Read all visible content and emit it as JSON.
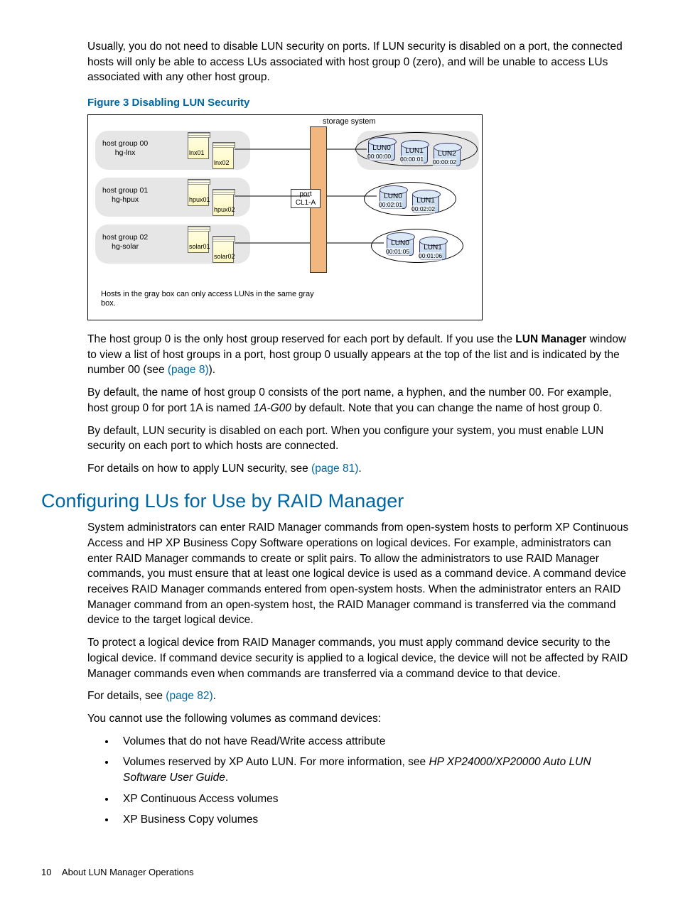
{
  "intro_para": "Usually, you do not need to disable LUN security on ports. If LUN security is disabled on a port, the connected hosts will only be able to access LUs associated with host group 0 (zero), and will be unable to access LUs associated with any other host group.",
  "figure_caption": "Figure 3 Disabling LUN Security",
  "diagram": {
    "storage_label": "storage system",
    "hg00_l1": "host group 00",
    "hg00_l2": "hg-lnx",
    "hg01_l1": "host group 01",
    "hg01_l2": "hg-hpux",
    "hg02_l1": "host group 02",
    "hg02_l2": "hg-solar",
    "srv_lnx01": "lnx01",
    "srv_lnx02": "lnx02",
    "srv_hpux01": "hpux01",
    "srv_hpux02": "hpux02",
    "srv_solar01": "solar01",
    "srv_solar02": "solar02",
    "port_l1": "port",
    "port_l2": "CL1-A",
    "g0_lun0": "LUN0",
    "g0_lun0_id": "00:00:00",
    "g0_lun1": "LUN1",
    "g0_lun1_id": "00:00:01",
    "g0_lun2": "LUN2",
    "g0_lun2_id": "00:00:02",
    "g1_lun0": "LUN0",
    "g1_lun0_id": "00:02:01",
    "g1_lun1": "LUN1",
    "g1_lun1_id": "00:02:02",
    "g2_lun0": "LUN0",
    "g2_lun0_id": "00:01:05",
    "g2_lun1": "LUN1",
    "g2_lun1_id": "00:01:06",
    "note": "Hosts in the gray box can only access LUNs in the same gray box."
  },
  "para2_pre": "The host group 0 is the only host group reserved for each port by default. If you use the ",
  "para2_bold": "LUN Manager",
  "para2_mid": " window to view a list of host groups in a port, host group 0 usually appears at the top of the list and is indicated by the number 00 (see ",
  "para2_link": "(page 8)",
  "para2_post": ").",
  "para3_pre": "By default, the name of host group 0 consists of the port name, a hyphen, and the number 00. For example, host group 0 for port 1A is named ",
  "para3_italic": "1A-G00",
  "para3_post": " by default. Note that you can change the name of host group 0.",
  "para4": "By default, LUN security is disabled on each port. When you configure your system, you must enable LUN security on each port to which hosts are connected.",
  "para5_pre": "For details on how to apply LUN security, see ",
  "para5_link": "(page 81)",
  "para5_post": ".",
  "heading2": "Configuring LUs for Use by RAID Manager",
  "para6": "System administrators can enter RAID Manager commands from open-system hosts to perform XP Continuous Access and HP XP Business Copy Software operations on logical devices. For example, administrators can enter RAID Manager commands to create or split pairs. To allow the administrators to use RAID Manager commands, you must ensure that at least one logical device is used as a command device. A command device receives RAID Manager commands entered from open-system hosts. When the administrator enters an RAID Manager command from an open-system host, the RAID Manager command is transferred via the command device to the target logical device.",
  "para7": "To protect a logical device from RAID Manager commands, you must apply command device security to the logical device. If command device security is applied to a logical device, the device will not be affected by RAID Manager commands even when commands are transferred via a command device to that device.",
  "para8_pre": "For details, see ",
  "para8_link": "(page 82)",
  "para8_post": ".",
  "para9": "You cannot use the following volumes as command devices:",
  "bullets": {
    "b1": "Volumes that do not have Read/Write access attribute",
    "b2_pre": "Volumes reserved by XP Auto LUN. For more information, see ",
    "b2_italic": "HP XP24000/XP20000 Auto LUN Software User Guide",
    "b2_post": ".",
    "b3": "XP Continuous Access volumes",
    "b4": "XP Business Copy volumes"
  },
  "footer_page": "10",
  "footer_title": "About LUN Manager Operations"
}
